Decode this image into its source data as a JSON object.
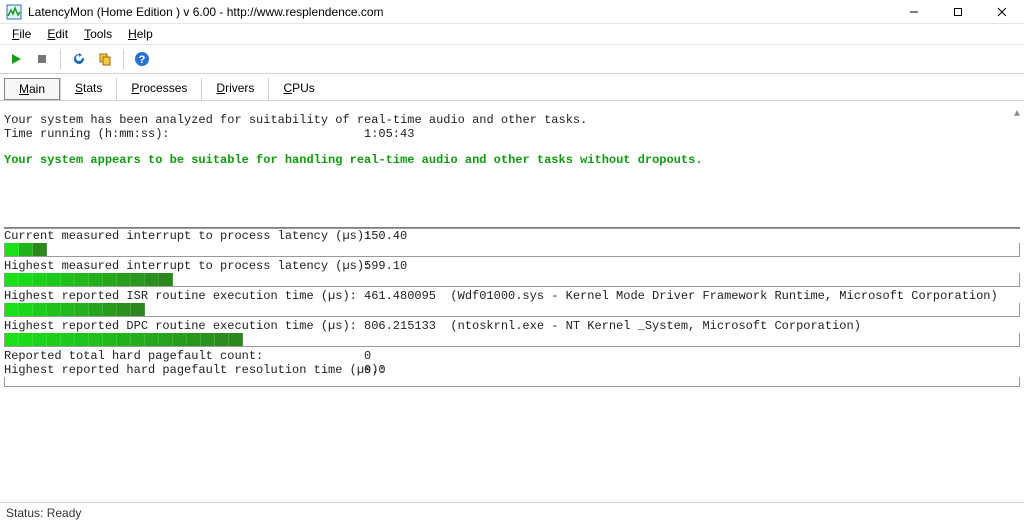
{
  "window": {
    "title": "LatencyMon  (Home Edition )  v 6.00 - http://www.resplendence.com"
  },
  "menus": [
    "File",
    "Edit",
    "Tools",
    "Help"
  ],
  "tabs": [
    {
      "label": "Main",
      "active": true
    },
    {
      "label": "Stats",
      "active": false
    },
    {
      "label": "Processes",
      "active": false
    },
    {
      "label": "Drivers",
      "active": false
    },
    {
      "label": "CPUs",
      "active": false
    }
  ],
  "report": {
    "analyzed_line": "Your system has been analyzed for suitability of real-time audio and other tasks.",
    "time_running_label": "Time running (h:mm:ss):",
    "time_running_value": "1:05:43",
    "verdict_line": "Your system appears to be suitable for handling real-time audio and other tasks without dropouts."
  },
  "metrics": {
    "current_itp_label": "Current measured interrupt to process latency (µs):",
    "current_itp_value": "150.40",
    "current_itp_segments": 3,
    "highest_itp_label": "Highest measured interrupt to process latency (µs):",
    "highest_itp_value": "599.10",
    "highest_itp_segments": 12,
    "highest_isr_label": "Highest reported ISR routine execution time (µs):",
    "highest_isr_value": "461.480095",
    "highest_isr_extra": "(Wdf01000.sys - Kernel Mode Driver Framework Runtime, Microsoft Corporation)",
    "highest_isr_segments": 10,
    "highest_dpc_label": "Highest reported DPC routine execution time (µs):",
    "highest_dpc_value": "806.215133",
    "highest_dpc_extra": "(ntoskrnl.exe - NT Kernel _System, Microsoft Corporation)",
    "highest_dpc_segments": 17,
    "hard_pf_count_label": "Reported total hard pagefault count:",
    "hard_pf_count_value": "0",
    "hard_pf_time_label": "Highest reported hard pagefault resolution time (µs):",
    "hard_pf_time_value": "0.0"
  },
  "status": {
    "text": "Status: Ready"
  },
  "colors": {
    "bar_grad_start": "#19e019",
    "bar_grad_end": "#2e7d1e",
    "verdict_green": "#109c10"
  }
}
